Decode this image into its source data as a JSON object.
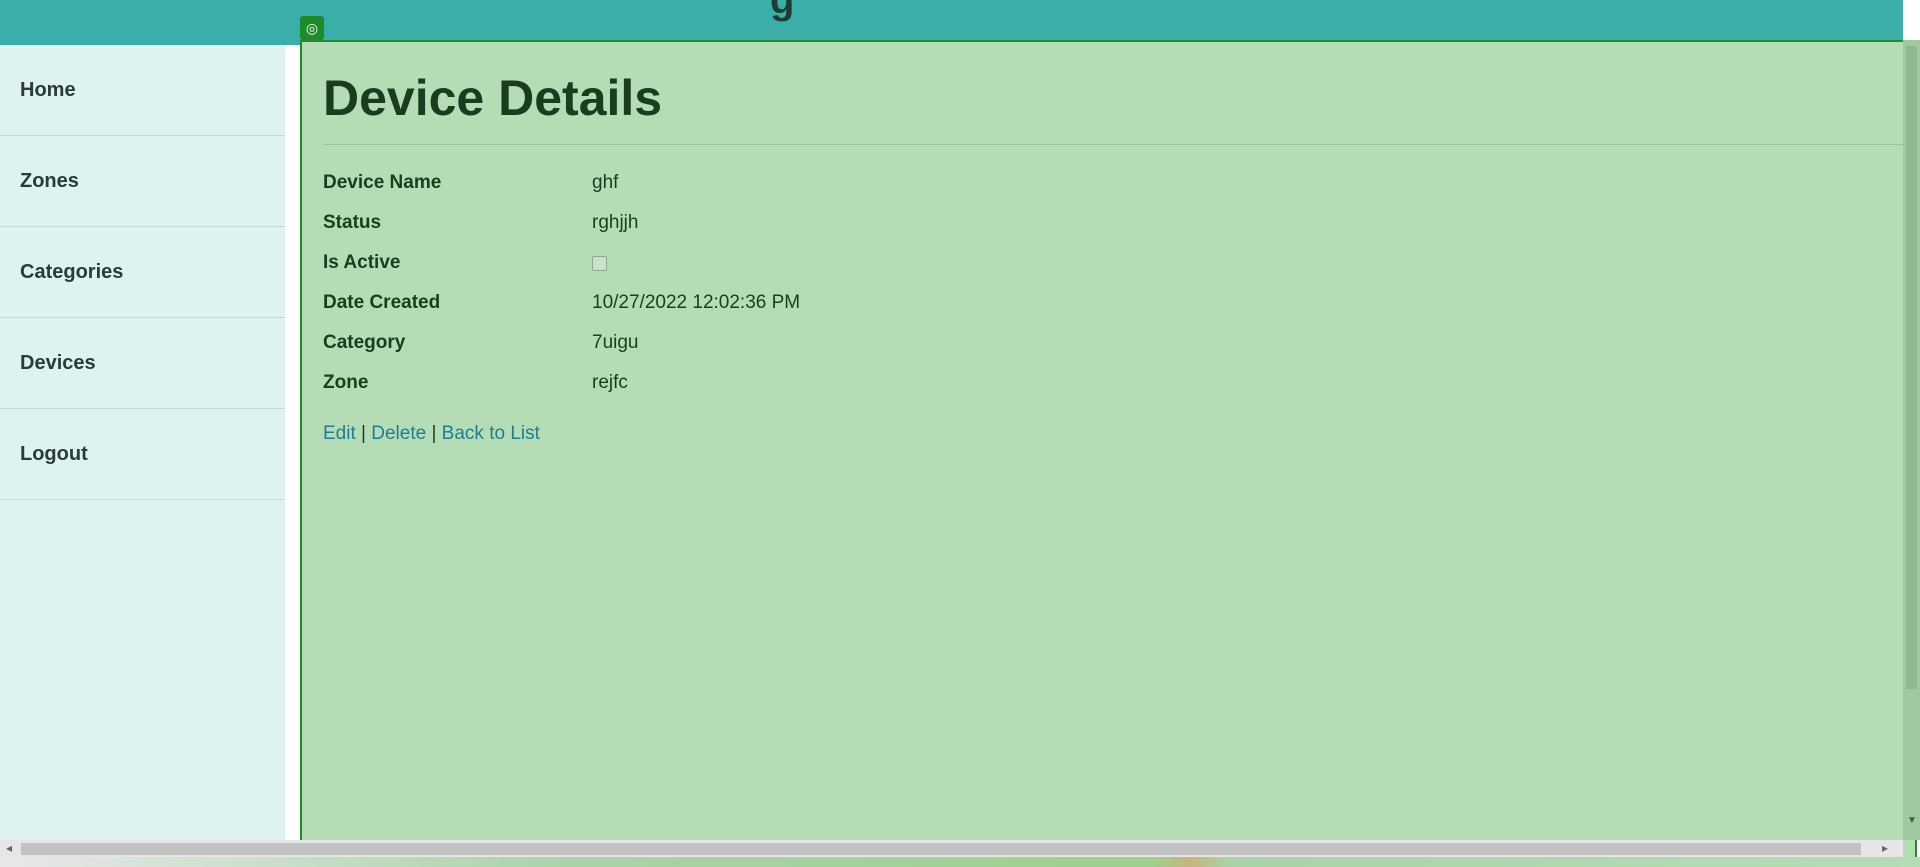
{
  "sidebar": {
    "items": [
      {
        "label": "Home"
      },
      {
        "label": "Zones"
      },
      {
        "label": "Categories"
      },
      {
        "label": "Devices"
      },
      {
        "label": "Logout"
      }
    ]
  },
  "page": {
    "title": "Device Details"
  },
  "details": {
    "device_name": {
      "label": "Device Name",
      "value": "ghf"
    },
    "status": {
      "label": "Status",
      "value": "rghjjh"
    },
    "is_active": {
      "label": "Is Active",
      "checked": false
    },
    "date_created": {
      "label": "Date Created",
      "value": "10/27/2022 12:02:36 PM"
    },
    "category": {
      "label": "Category",
      "value": "7uigu"
    },
    "zone": {
      "label": "Zone",
      "value": "rejfc"
    }
  },
  "actions": {
    "edit": "Edit",
    "separator": "|",
    "delete": "Delete",
    "back": "Back to List"
  },
  "colors": {
    "header": "#3aafa9",
    "sidebar": "#def2f1",
    "overlay": "#b4ddb5",
    "link": "#207d98"
  },
  "icons": {
    "overlay_badge": "target-icon"
  }
}
